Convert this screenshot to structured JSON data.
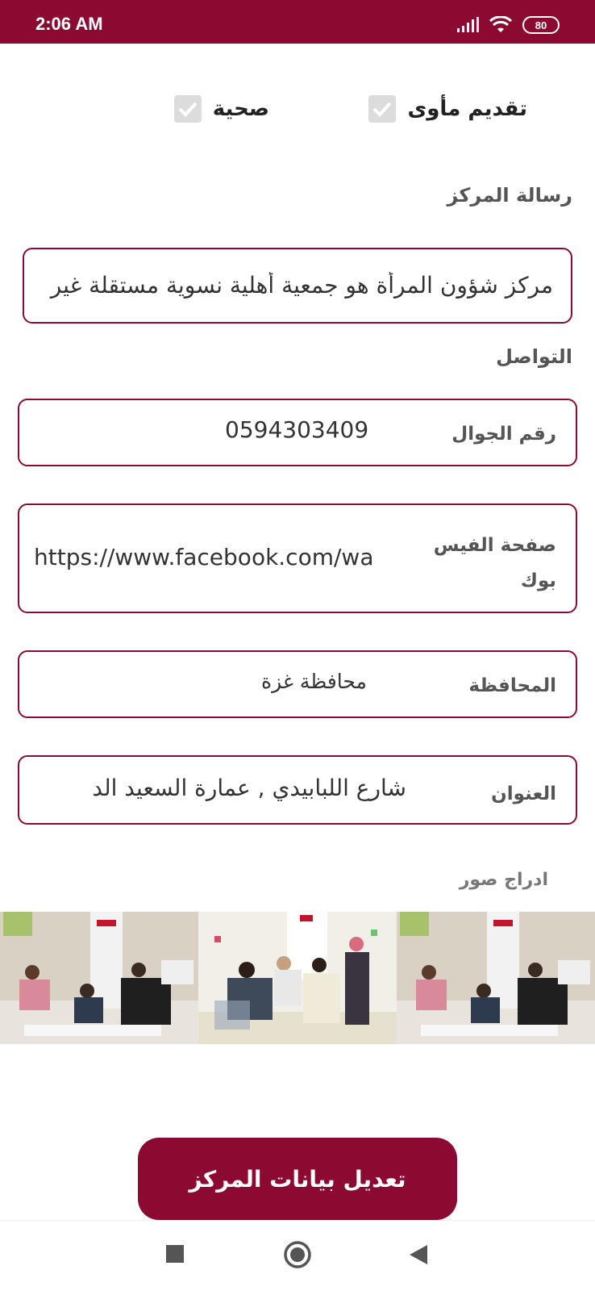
{
  "status": {
    "time": "2:06 AM",
    "battery": "80"
  },
  "services": [
    {
      "label": "تقديم مأوى",
      "checked": true
    },
    {
      "label": "صحية",
      "checked": true
    }
  ],
  "mission": {
    "label": "رسالة المركز",
    "value": "مركز شؤون المرأة هو جمعية أهلية نسوية مستقلة غير"
  },
  "contact": {
    "label": "التواصل",
    "phone": {
      "label": "رقم الجوال",
      "value": "0594303409"
    },
    "facebook": {
      "label": "صفحة الفيس بوك",
      "value": "https://www.facebook.com/wa"
    },
    "governorate": {
      "label": "المحافظة",
      "value": "محافظة غزة"
    },
    "address": {
      "label": "العنوان",
      "value": "شارع اللبابيدي , عمارة السعيد الد"
    }
  },
  "images": {
    "label": "ادراج صور"
  },
  "submit": {
    "label": "تعديل بيانات المركز"
  },
  "colors": {
    "accent": "#8c0a31"
  },
  "icons": [
    "signal-icon",
    "wifi-icon",
    "battery-icon",
    "check-icon",
    "nav-square-icon",
    "nav-home-icon",
    "nav-back-icon"
  ]
}
